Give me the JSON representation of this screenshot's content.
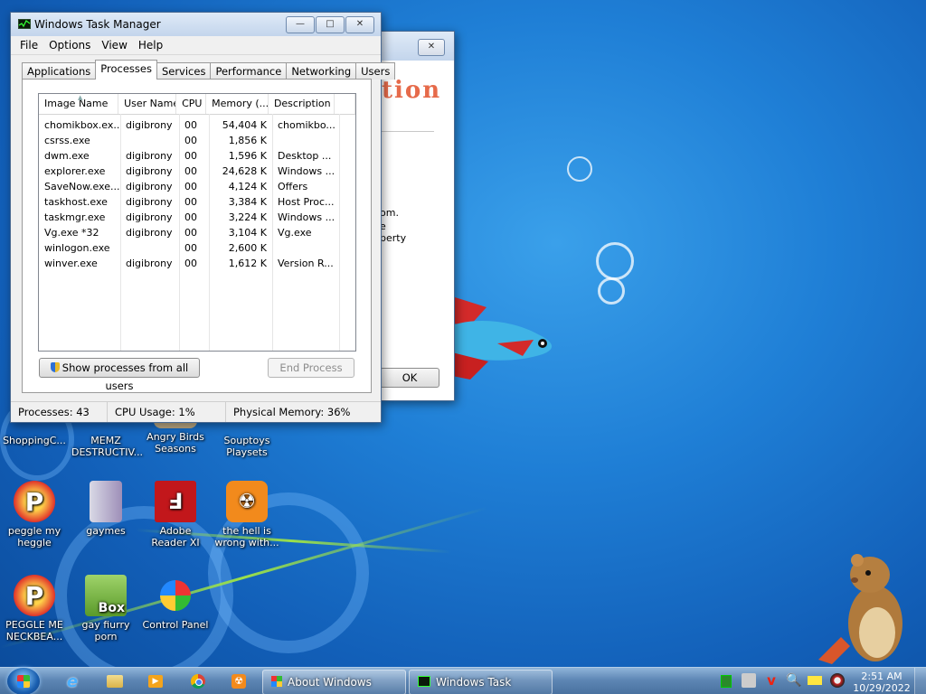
{
  "task_manager": {
    "title": "Windows Task Manager",
    "menu": [
      "File",
      "Options",
      "View",
      "Help"
    ],
    "tabs": [
      "Applications",
      "Processes",
      "Services",
      "Performance",
      "Networking",
      "Users"
    ],
    "active_tab": "Processes",
    "columns": [
      "Image Name",
      "User Name",
      "CPU",
      "Memory (...",
      "Description"
    ],
    "processes": [
      {
        "image": "chomikbox.ex...",
        "user": "digibrony",
        "cpu": "00",
        "memory": "54,404 K",
        "description": "chomikbo..."
      },
      {
        "image": "csrss.exe",
        "user": "",
        "cpu": "00",
        "memory": "1,856 K",
        "description": ""
      },
      {
        "image": "dwm.exe",
        "user": "digibrony",
        "cpu": "00",
        "memory": "1,596 K",
        "description": "Desktop ..."
      },
      {
        "image": "explorer.exe",
        "user": "digibrony",
        "cpu": "00",
        "memory": "24,628 K",
        "description": "Windows ..."
      },
      {
        "image": "SaveNow.exe...",
        "user": "digibrony",
        "cpu": "00",
        "memory": "4,124 K",
        "description": "Offers"
      },
      {
        "image": "taskhost.exe",
        "user": "digibrony",
        "cpu": "00",
        "memory": "3,384 K",
        "description": "Host Proc..."
      },
      {
        "image": "taskmgr.exe",
        "user": "digibrony",
        "cpu": "00",
        "memory": "3,224 K",
        "description": "Windows ..."
      },
      {
        "image": "Vg.exe *32",
        "user": "digibrony",
        "cpu": "00",
        "memory": "3,104 K",
        "description": "Vg.exe"
      },
      {
        "image": "winlogon.exe",
        "user": "",
        "cpu": "00",
        "memory": "2,600 K",
        "description": ""
      },
      {
        "image": "winver.exe",
        "user": "digibrony",
        "cpu": "00",
        "memory": "1,612 K",
        "description": "Version R..."
      }
    ],
    "show_all_label": "Show processes from all users",
    "end_process_label": "End Process",
    "status": {
      "processes": "Processes: 43",
      "cpu": "CPU Usage: 1%",
      "memory": "Physical Memory: 36%"
    }
  },
  "about_window": {
    "title_fragment": "tion",
    "text_lines": [
      "om.",
      "e",
      "perty"
    ],
    "ok_label": "OK"
  },
  "desktop_icons": [
    {
      "label": "ShoppingC...",
      "icon": "shopping-icon"
    },
    {
      "label": "MEMZ DESTRUCTIV...",
      "icon": "memz-icon"
    },
    {
      "label": "Angry Birds Seasons",
      "icon": "angry-birds-icon"
    },
    {
      "label": "Souptoys Playsets",
      "icon": "souptoys-icon"
    },
    {
      "label": "peggle my heggle",
      "icon": "peggle-icon"
    },
    {
      "label": "gaymes",
      "icon": "folder-icon"
    },
    {
      "label": "Adobe Reader XI",
      "icon": "adobe-reader-icon"
    },
    {
      "label": "the hell is wrong with...",
      "icon": "uc-browser-icon"
    },
    {
      "label": "PEGGLE ME NECKBEA...",
      "icon": "peggle-icon"
    },
    {
      "label": "gay fiurry porn",
      "icon": "box-icon"
    },
    {
      "label": "Control Panel",
      "icon": "control-panel-icon"
    }
  ],
  "taskbar": {
    "tasks": [
      "About Windows",
      "Windows Task Mana..."
    ],
    "clock_time": "2:51 AM",
    "clock_date": "10/29/2022"
  },
  "colors": {
    "desktop": "#1f7fd6",
    "taskbar": "#5d86b4"
  }
}
